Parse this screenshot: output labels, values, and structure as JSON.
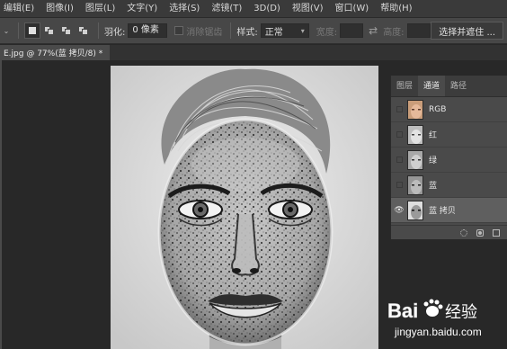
{
  "menu": [
    "编辑(E)",
    "图像(I)",
    "图层(L)",
    "文字(Y)",
    "选择(S)",
    "滤镜(T)",
    "3D(D)",
    "视图(V)",
    "窗口(W)",
    "帮助(H)"
  ],
  "options": {
    "feather_label": "羽化:",
    "feather_value": "0 像素",
    "antialias_label": "消除锯齿",
    "style_label": "样式:",
    "style_value": "正常",
    "width_label": "宽度:",
    "height_label": "高度:",
    "select_mask_button": "选择并遮住 ..."
  },
  "document": {
    "tab_title": "E.jpg @ 77%(蓝 拷贝/8) *"
  },
  "panel": {
    "tabs": [
      "图层",
      "通道",
      "路径"
    ],
    "active_tab": "通道",
    "channels": [
      {
        "name": "RGB",
        "visible": false,
        "selected": false,
        "thumb": "color"
      },
      {
        "name": "红",
        "visible": false,
        "selected": false,
        "thumb": "gray"
      },
      {
        "name": "绿",
        "visible": false,
        "selected": false,
        "thumb": "gray"
      },
      {
        "name": "蓝",
        "visible": false,
        "selected": false,
        "thumb": "gray"
      },
      {
        "name": "蓝 拷贝",
        "visible": true,
        "selected": true,
        "thumb": "mask"
      }
    ],
    "footer_icons": [
      "dotted-circle-icon",
      "save-selection-icon",
      "new-channel-icon",
      "delete-icon"
    ]
  },
  "watermark": {
    "brand": "Bai",
    "brand2": "经验",
    "url": "jingyan.baidu.com"
  },
  "colors": {
    "menubar": "#3a3a3a",
    "optbar": "#474747",
    "panel": "#4a4a4a",
    "canvas_bg": "#282828",
    "selected_row": "#5f5f5f"
  }
}
